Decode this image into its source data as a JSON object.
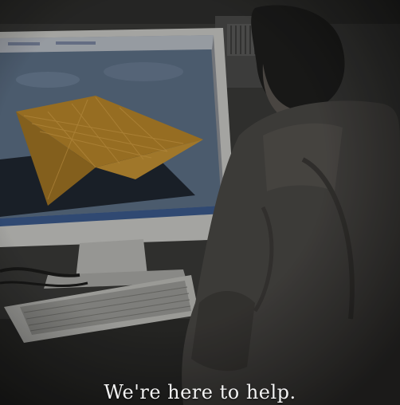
{
  "photo": {
    "subject": "person-working-at-computer-with-3d-model",
    "tint": "#2b2b2b"
  },
  "caption": {
    "text": "We're here to help.",
    "color": "#f2f2f2"
  }
}
